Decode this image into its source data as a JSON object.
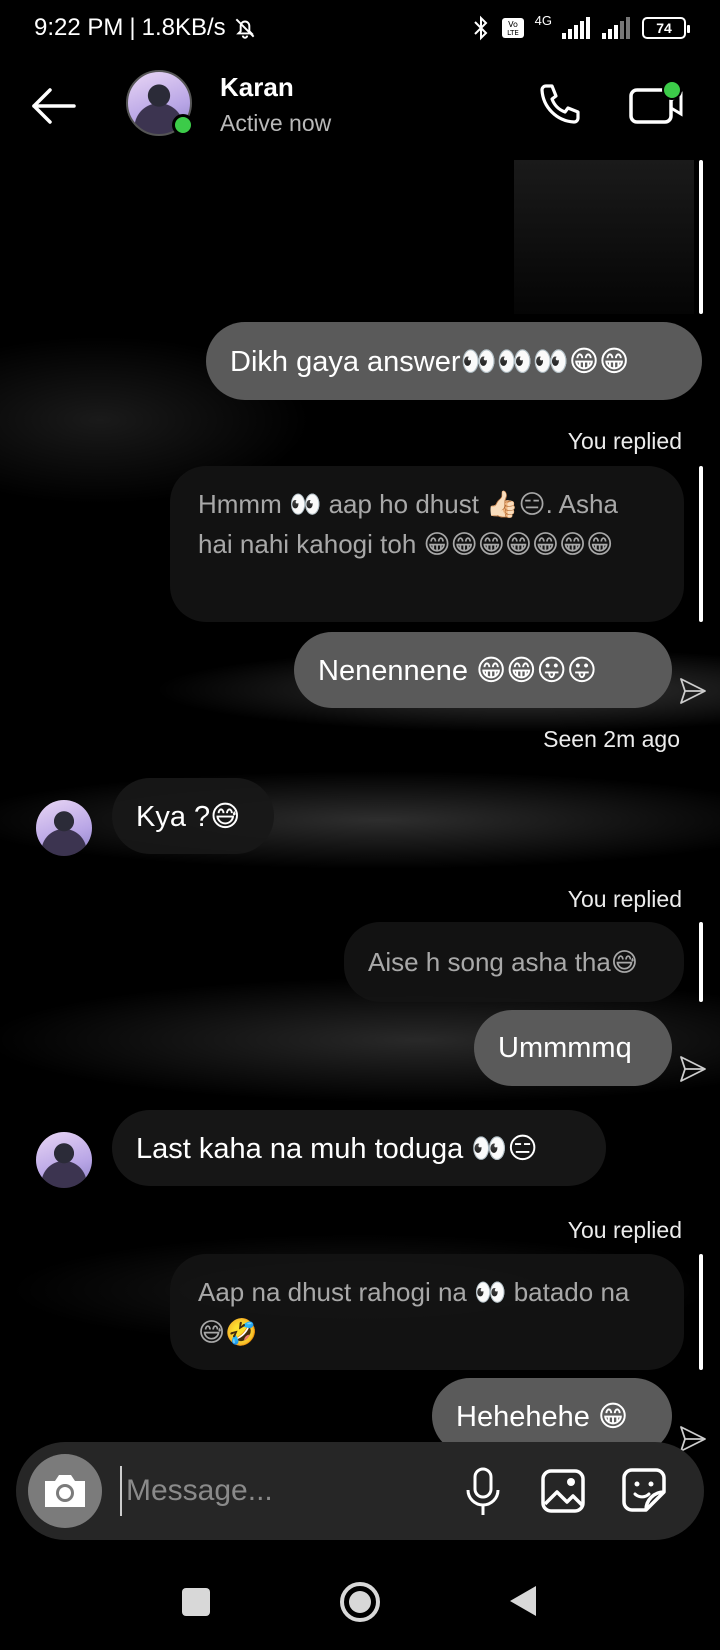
{
  "status_bar": {
    "time": "9:22 PM",
    "separator": "|",
    "speed": "1.8KB/s",
    "network": "4G",
    "battery": "74"
  },
  "header": {
    "contact_name": "Karan",
    "status": "Active now"
  },
  "messages": [
    {
      "type": "sent",
      "text": "Dikh gaya answer👀👀👀😁😁"
    },
    {
      "type": "reply_label",
      "text": "You replied"
    },
    {
      "type": "reply_quote",
      "text": "Hmmm 👀 aap ho dhust 👍🏻😑. Asha hai nahi kahogi toh 😁😁😁😁😁😁😁"
    },
    {
      "type": "sent",
      "text": "Nenennene 😁😁😛😛"
    },
    {
      "type": "seen",
      "text": "Seen 2m ago"
    },
    {
      "type": "received",
      "text": "Kya ?😅"
    },
    {
      "type": "reply_label",
      "text": "You replied"
    },
    {
      "type": "reply_quote",
      "text": "Aise h song asha tha😅"
    },
    {
      "type": "sent",
      "text": "Ummmmq"
    },
    {
      "type": "received",
      "text": "Last kaha na muh toduga 👀😑"
    },
    {
      "type": "reply_label",
      "text": "You replied"
    },
    {
      "type": "reply_quote",
      "text": "Aap na dhust rahogi na 👀 batado na 😅🤣"
    },
    {
      "type": "sent",
      "text": "Hehehehe 😁"
    }
  ],
  "composer": {
    "placeholder": "Message..."
  },
  "colors": {
    "sent_bubble": "#5a5a5a",
    "received_bubble": "#181818",
    "online": "#3ccb49",
    "background": "#000000"
  }
}
